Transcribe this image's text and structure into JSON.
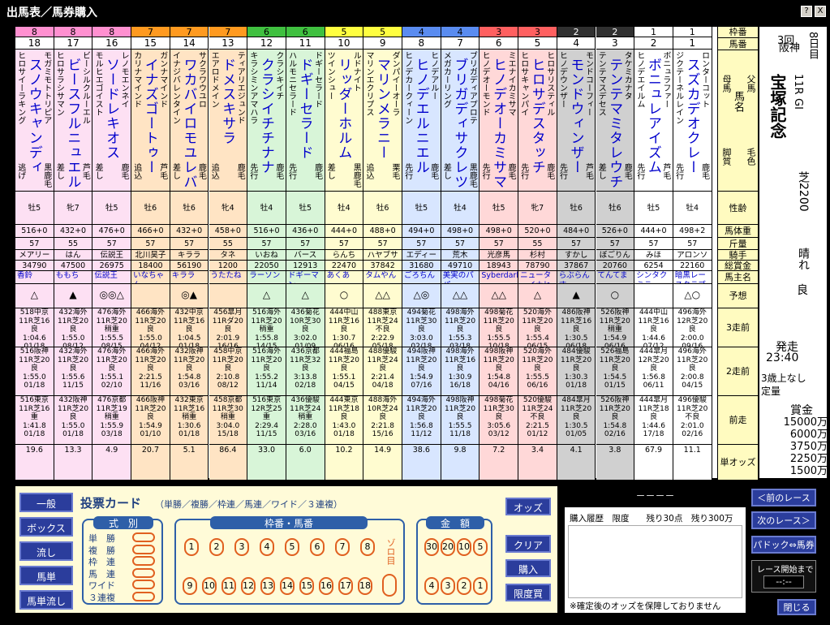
{
  "window": {
    "title": "出馬表／馬券購入",
    "help": "?",
    "close": "X"
  },
  "header_labels": [
    "枠番",
    "馬番",
    "父馬",
    "馬名",
    "母馬",
    "毛色",
    "脚質",
    "性齢",
    "馬体重",
    "斤量",
    "騎手",
    "総賞金",
    "馬主名",
    "予想",
    "3走前",
    "2走前",
    "前走",
    "単オッズ"
  ],
  "horses": [
    {
      "waku": "8",
      "num": "18",
      "sire": "モガミモトトリピア",
      "name": "スノウキャンディ",
      "dam": "ヒロサイーラキング",
      "coat": "黒鹿毛",
      "style": "逃げ",
      "sex": "牡5",
      "weight": "516+0",
      "kin": "57",
      "jockey": "メアリー",
      "prize": "34790",
      "owner": "香鈴",
      "pred": "△",
      "r3": [
        "518中京",
        "11R芝16",
        "良",
        "1:04.6",
        "01/18"
      ],
      "r2": [
        "516阪神",
        "11R芝20",
        "良",
        "1:55.0",
        "01/18"
      ],
      "r1": [
        "516東京",
        "11R芝16",
        "重",
        "1:41.8",
        "01/18"
      ],
      "odds": "19.6"
    },
    {
      "waku": "8",
      "num": "17",
      "sire": "ビーシルクルーエル",
      "name": "ビースフルニュエル",
      "dam": "ヒロサラシサマン",
      "coat": "芦毛",
      "style": "差し",
      "sex": "牝7",
      "weight": "432+0",
      "kin": "55",
      "jockey": "はん",
      "prize": "47500",
      "owner": "ももち",
      "pred": "▲",
      "r3": [
        "432海外",
        "11R芝20",
        "良",
        "1:55.0",
        "08/12"
      ],
      "r2": [
        "432海外",
        "11R芝20",
        "良",
        "1:55.6",
        "11/15"
      ],
      "r1": [
        "432阪神",
        "11R芝20",
        "良",
        "1:55.0",
        "01/18"
      ],
      "odds": "13.3"
    },
    {
      "waku": "8",
      "num": "16",
      "sire": "レノモエンネイ",
      "name": "ソードレキオス",
      "dam": "モルヒエゴイスト",
      "coat": "鹿毛",
      "style": "差し",
      "sex": "牡5",
      "weight": "476+0",
      "kin": "57",
      "jockey": "伝説王",
      "prize": "26975",
      "owner": "伝説王",
      "pred": "◎◎△",
      "r3": [
        "476海外",
        "11R芝20",
        "稍重",
        "1:55.5",
        "08/15"
      ],
      "r2": [
        "476海外",
        "11R芝20",
        "良",
        "1:55.1",
        "02/10"
      ],
      "r1": [
        "476京都",
        "11R芝19",
        "稍重",
        "1:55.9",
        "03/18"
      ],
      "odds": "4.9"
    },
    {
      "waku": "7",
      "num": "15",
      "sire": "ガンナマインド",
      "name": "イナズゴートゥー",
      "dam": "カリナマインド",
      "coat": "芦毛",
      "style": "追込",
      "sex": "牡6",
      "weight": "466+0",
      "kin": "57",
      "jockey": "北川昊子",
      "prize": "18400",
      "owner": "いなちゃん",
      "pred": "",
      "r3": [
        "466海外",
        "11R芝20",
        "良",
        "1:55.0",
        "04/12"
      ],
      "r2": [
        "466海外",
        "11R芝20",
        "良",
        "2:21.5",
        "11/16"
      ],
      "r1": [
        "466阪神",
        "11R芝20",
        "良",
        "1:54.9",
        "01/10"
      ],
      "odds": "20.7"
    },
    {
      "waku": "7",
      "num": "14",
      "sire": "サクラワウユロ",
      "name": "ワカバイロモユレバ",
      "dam": "イナジバレンタイン",
      "coat": "鹿毛",
      "style": "差し",
      "sex": "牡6",
      "weight": "432+0",
      "kin": "57",
      "jockey": "キララ",
      "prize": "56190",
      "owner": "キララ",
      "pred": "◎▲",
      "r3": [
        "432中京",
        "11R芝16",
        "良",
        "1:04.5",
        "01/18"
      ],
      "r2": [
        "432阪神",
        "11R芝20",
        "良",
        "1:54.8",
        "03/16"
      ],
      "r1": [
        "432東京",
        "11R芝16",
        "稍重",
        "1:30.6",
        "01/18"
      ],
      "odds": "5.1"
    },
    {
      "waku": "7",
      "num": "13",
      "sire": "ティアリエジュンド",
      "name": "ドメスキサラ",
      "dam": "エアロドメイン",
      "coat": "鹿毛",
      "style": "追込",
      "sex": "牝4",
      "weight": "458+0",
      "kin": "55",
      "jockey": "タネ",
      "prize": "1200",
      "owner": "うたたね",
      "pred": "",
      "r3": [
        "456皐月",
        "11Rダ20",
        "良",
        "2:01.9",
        "16/16"
      ],
      "r2": [
        "458中京",
        "11R芝20",
        "良",
        "2:10.8",
        "08/12"
      ],
      "r1": [
        "458京都",
        "11R芝30",
        "稍重",
        "3:04.0",
        "15/18"
      ],
      "odds": "86.4"
    },
    {
      "waku": "6",
      "num": "12",
      "sire": "クラシキイチ",
      "name": "クラシイチチナナ",
      "dam": "キラシミンアマハラ",
      "coat": "鹿毛",
      "style": "先行",
      "sex": "牡4",
      "weight": "516+0",
      "kin": "57",
      "jockey": "いおね",
      "prize": "22050",
      "owner": "ラーソン",
      "pred": "△",
      "r3": [
        "516海外",
        "11R芝20",
        "稍重",
        "1:55.8",
        "14/15"
      ],
      "r2": [
        "516海外",
        "11R芝20",
        "良",
        "1:55.2",
        "11/14"
      ],
      "r1": [
        "516東京",
        "12R芝25",
        "重",
        "2:29.4",
        "11/15"
      ],
      "odds": "33.0"
    },
    {
      "waku": "6",
      "num": "11",
      "sire": "ドギーセラード",
      "name": "ドギーセラード",
      "dam": "ハルモニセラード",
      "coat": "鹿毛",
      "style": "先行",
      "sex": "牡5",
      "weight": "436+0",
      "kin": "57",
      "jockey": "バース",
      "prize": "12913",
      "owner": "ドギーマン",
      "pred": "△",
      "r3": [
        "436菊花",
        "10R芝30",
        "良",
        "3:02.0",
        "01/09"
      ],
      "r2": [
        "436京都",
        "11R芝32",
        "良",
        "3:13.8",
        "02/18"
      ],
      "r1": [
        "436優駿",
        "11R芝24",
        "稍重",
        "2:28.0",
        "03/16"
      ],
      "odds": "6.0"
    },
    {
      "waku": "5",
      "num": "10",
      "sire": "ルドナイト",
      "name": "リッダーホルム",
      "dam": "ツインシュー",
      "coat": "黒鹿毛",
      "style": "差し",
      "sex": "牡4",
      "weight": "444+0",
      "kin": "57",
      "jockey": "らんち",
      "prize": "22470",
      "owner": "あくあ",
      "pred": "○",
      "r3": [
        "444中山",
        "11R芝16",
        "良",
        "1:30.7",
        "06/16"
      ],
      "r2": [
        "444福島",
        "11R芝20",
        "良",
        "1:55.1",
        "04/15"
      ],
      "r1": [
        "444東京",
        "11R芝18",
        "良",
        "1:43.0",
        "01/18"
      ],
      "odds": "10.2"
    },
    {
      "waku": "5",
      "num": "9",
      "sire": "ダンパイーオーラ",
      "name": "マリンメラニー",
      "dam": "マリンエクリプス",
      "coat": "栗毛",
      "style": "追込",
      "sex": "牡6",
      "weight": "488+0",
      "kin": "57",
      "jockey": "ハヤブサ",
      "prize": "37842",
      "owner": "タムやん",
      "pred": "△△",
      "r3": [
        "488東京",
        "11R芝24",
        "不良",
        "2:22.9",
        "05/18"
      ],
      "r2": [
        "488優駿",
        "11R芝24",
        "良",
        "2:21.4",
        "04/18"
      ],
      "r1": [
        "488海外",
        "10R芝24",
        "良",
        "2:21.8",
        "15/16"
      ],
      "odds": "14.9"
    },
    {
      "waku": "4",
      "num": "8",
      "sire": "ヒノデアルー",
      "name": "ヒノデエルニエル",
      "dam": "ヒノデカークィーン",
      "coat": "鹿毛",
      "style": "先行",
      "sex": "牡5",
      "weight": "494+0",
      "kin": "57",
      "jockey": "エディー",
      "prize": "31680",
      "owner": "ごろちん",
      "pred": "△◎",
      "r3": [
        "494菊花",
        "11R芝30",
        "良",
        "3:03.0",
        "02/18"
      ],
      "r2": [
        "494阪神",
        "11R芝20",
        "良",
        "1:54.9",
        "07/16"
      ],
      "r1": [
        "494海外",
        "11R芝20",
        "良",
        "1:56.8",
        "11/12"
      ],
      "odds": "38.6"
    },
    {
      "waku": "4",
      "num": "7",
      "sire": "ブリガディアプロテ",
      "name": "ブリガディサクレツ",
      "dam": "メガカーリング",
      "coat": "黒鹿毛",
      "style": "差し",
      "sex": "牡4",
      "weight": "498+0",
      "kin": "57",
      "jockey": "荒木",
      "prize": "49710",
      "owner": "美実のパパ",
      "pred": "△△",
      "r3": [
        "498海外",
        "11R芝20",
        "良",
        "1:55.3",
        "03/18"
      ],
      "r2": [
        "498海外",
        "11R芝16",
        "良",
        "1:30.9",
        "16/18"
      ],
      "r1": [
        "498阪神",
        "11R芝20",
        "良",
        "1:55.5",
        "11/18"
      ],
      "odds": "9.8"
    },
    {
      "waku": "3",
      "num": "6",
      "sire": "ミエナイカミサマ",
      "name": "ヒノデオーカミサマ",
      "dam": "ヒノデオーモンド",
      "coat": "鹿毛",
      "style": "先行",
      "sex": "牡5",
      "weight": "498+0",
      "kin": "57",
      "jockey": "光彦馬",
      "prize": "18943",
      "owner": "Syberdark",
      "pred": "△△",
      "r3": [
        "498菊花",
        "11R芝20",
        "良",
        "1:55.5",
        "10/18"
      ],
      "r2": [
        "498阪神",
        "11R芝20",
        "良",
        "1:54.8",
        "04/16"
      ],
      "r1": [
        "498菊花",
        "11R芝30",
        "良",
        "3:05.6",
        "03/12"
      ],
      "odds": "7.2"
    },
    {
      "waku": "3",
      "num": "5",
      "sire": "ヒロサリスティル",
      "name": "ヒロサデスタッチ",
      "dam": "ヒロサキャンパイ",
      "coat": "鹿毛",
      "style": "先行",
      "sex": "牝7",
      "weight": "520+0",
      "kin": "55",
      "jockey": "杉村",
      "prize": "78790",
      "owner": "ニューターイナヒロ",
      "pred": "△",
      "r3": [
        "520海外",
        "11R芝20",
        "良",
        "1:55.4",
        "06/15"
      ],
      "r2": [
        "520海外",
        "11R芝20",
        "良",
        "1:55.5",
        "06/16"
      ],
      "r1": [
        "520優駿",
        "11R芝24",
        "不良",
        "2:21.5",
        "01/12"
      ],
      "odds": "3.4"
    },
    {
      "waku": "2",
      "num": "4",
      "sire": "モンドコーフィー",
      "name": "モンドウィンザー",
      "dam": "ヒノデウンザー",
      "coat": "芦毛",
      "style": "先行",
      "sex": "牡6",
      "weight": "484+0",
      "kin": "57",
      "jockey": "すかし",
      "prize": "37867",
      "owner": "らぶらんす",
      "pred": "▲",
      "r3": [
        "486阪神",
        "11R芝16",
        "良",
        "1:30.5",
        "06/18"
      ],
      "r2": [
        "484優駿",
        "11R芝20",
        "良",
        "1:30.3",
        "01/18"
      ],
      "r1": [
        "484皐月",
        "11R芝20",
        "良",
        "1:30.5",
        "01/05"
      ],
      "odds": "4.1"
    },
    {
      "waku": "2",
      "num": "3",
      "sire": "タケミカナタ",
      "name": "テンテマミタレウチ",
      "dam": "テンテマスデセス",
      "coat": "鹿毛",
      "style": "差し",
      "sex": "牡6",
      "weight": "526+0",
      "kin": "57",
      "jockey": "ぼごりん",
      "prize": "20760",
      "owner": "てんてま",
      "pred": "○",
      "r3": [
        "526阪神",
        "11R芝20",
        "稍重",
        "1:54.9",
        "06/16"
      ],
      "r2": [
        "526福島",
        "11R芝20",
        "良",
        "1:54.5",
        "01/15"
      ],
      "r1": [
        "526阪神",
        "11R芝20",
        "良",
        "1:54.8",
        "02/16"
      ],
      "odds": "3.8"
    },
    {
      "waku": "1",
      "num": "2",
      "sire": "ボニュラファー",
      "name": "ボニュレアイズム",
      "dam": "ヒノデエイルム",
      "coat": "芦毛",
      "style": "先行",
      "sex": "牡5",
      "weight": "444+0",
      "kin": "57",
      "jockey": "みほ",
      "prize": "6254",
      "owner": "シンタクミラ",
      "pred": "",
      "r3": [
        "444中山",
        "11R芝16",
        "良",
        "1:44.6",
        "07/12"
      ],
      "r2": [
        "444皐月",
        "12R芝20",
        "良",
        "1:56.8",
        "06/11"
      ],
      "r1": [
        "444皐月",
        "11R芝18",
        "良",
        "1:44.6",
        "17/18"
      ],
      "odds": "67.9"
    },
    {
      "waku": "1",
      "num": "1",
      "sire": "ロンターコット",
      "name": "スズカデオクレー",
      "dam": "ジクテーネルレイン",
      "coat": "鹿毛",
      "style": "先行",
      "sex": "牡4",
      "weight": "498+2",
      "kin": "57",
      "jockey": "アロンソ",
      "prize": "22160",
      "owner": "暗黒レースクラブ",
      "pred": "△○",
      "r3": [
        "496海外",
        "12R芝20",
        "良",
        "2:00.0",
        "09/16"
      ],
      "r2": [
        "496海外",
        "11R芝20",
        "良",
        "2:00.8",
        "04/15"
      ],
      "r1": [
        "496優駿",
        "11R芝20",
        "不良",
        "2:01.0",
        "02/16"
      ],
      "odds": "11.1"
    }
  ],
  "race_info": {
    "kai": "3回",
    "place": "阪神",
    "day": "8日目",
    "race": "11R",
    "grade": "GI",
    "name": "宝塚記念",
    "course": "芝2200",
    "weather": "晴れ",
    "track": "良",
    "start_label": "発走",
    "start_time": "23:40",
    "cond1": "3歳上なし",
    "cond2": "定量",
    "prize_label": "賞金",
    "prizes": [
      "15000万",
      "6000万",
      "3750万",
      "2250万",
      "1500万"
    ]
  },
  "left_buttons": [
    "一般",
    "ボックス",
    "流し",
    "馬単",
    "馬単流し"
  ],
  "card": {
    "title": "投票カード",
    "subtitle": "（単勝／複勝／枠連／馬連／ワイド／３連複）",
    "shiki_label": "式　別",
    "types": [
      "単　勝",
      "複　勝",
      "枠　連",
      "馬　連",
      "ワイド",
      "３連複"
    ],
    "waku_label": "枠番・馬番",
    "nums_top": [
      "1",
      "2",
      "3",
      "4",
      "5",
      "6",
      "7",
      "8"
    ],
    "nums_bottom": [
      "9",
      "10",
      "11",
      "12",
      "13",
      "14",
      "15",
      "16",
      "17",
      "18"
    ],
    "zoro": "ゾロ目",
    "amount_label": "金　額",
    "amt_top": [
      "30",
      "20",
      "10",
      "5"
    ],
    "amt_bottom": [
      "4",
      "3",
      "2",
      "1"
    ]
  },
  "right_buttons": [
    "オッズ",
    "クリア",
    "購入",
    "限度買"
  ],
  "history": {
    "top": "－－－－",
    "header": "購入履歴　限度　　残り30点　残り300万",
    "note": "※確定後のオッズを保障しておりません"
  },
  "nav": {
    "prev": "＜前のレース",
    "next": "次のレース＞",
    "paddock": "パドック⇔馬券",
    "countdown_label": "レース開始まで",
    "countdown": "--:--",
    "close": "閉じる"
  },
  "colors": {
    "w1": "#ffffff",
    "w2": "#303030",
    "w3": "#ff6060",
    "w4": "#5a8cf0",
    "w5": "#ffff40",
    "w6": "#40c040",
    "w7": "#ff9a20",
    "w8": "#ff90d0"
  }
}
